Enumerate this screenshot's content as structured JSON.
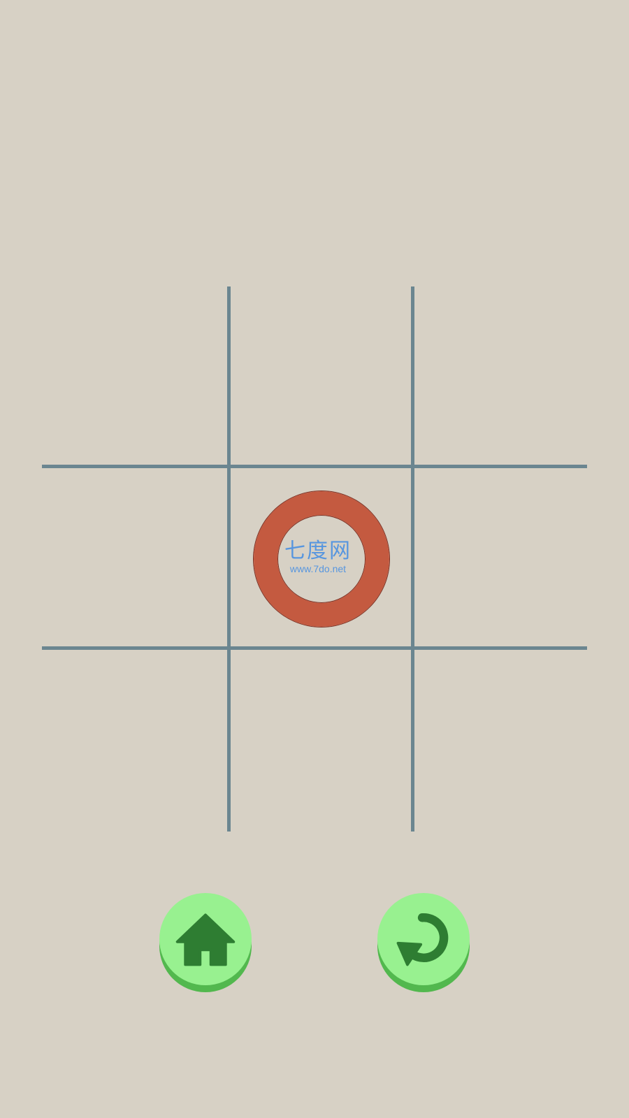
{
  "game": {
    "board": [
      [
        "",
        "",
        ""
      ],
      [
        "",
        "O",
        ""
      ],
      [
        "",
        "",
        ""
      ]
    ],
    "colors": {
      "background": "#d7d1c5",
      "grid_line": "#6b8690",
      "piece_o": "#c45a40",
      "button_face": "#98f190",
      "button_shadow": "#52b84e",
      "button_icon": "#2e7d32"
    }
  },
  "watermark": {
    "main": "七度网",
    "sub": "www.7do.net"
  },
  "controls": {
    "home_icon": "home-icon",
    "restart_icon": "restart-icon"
  }
}
